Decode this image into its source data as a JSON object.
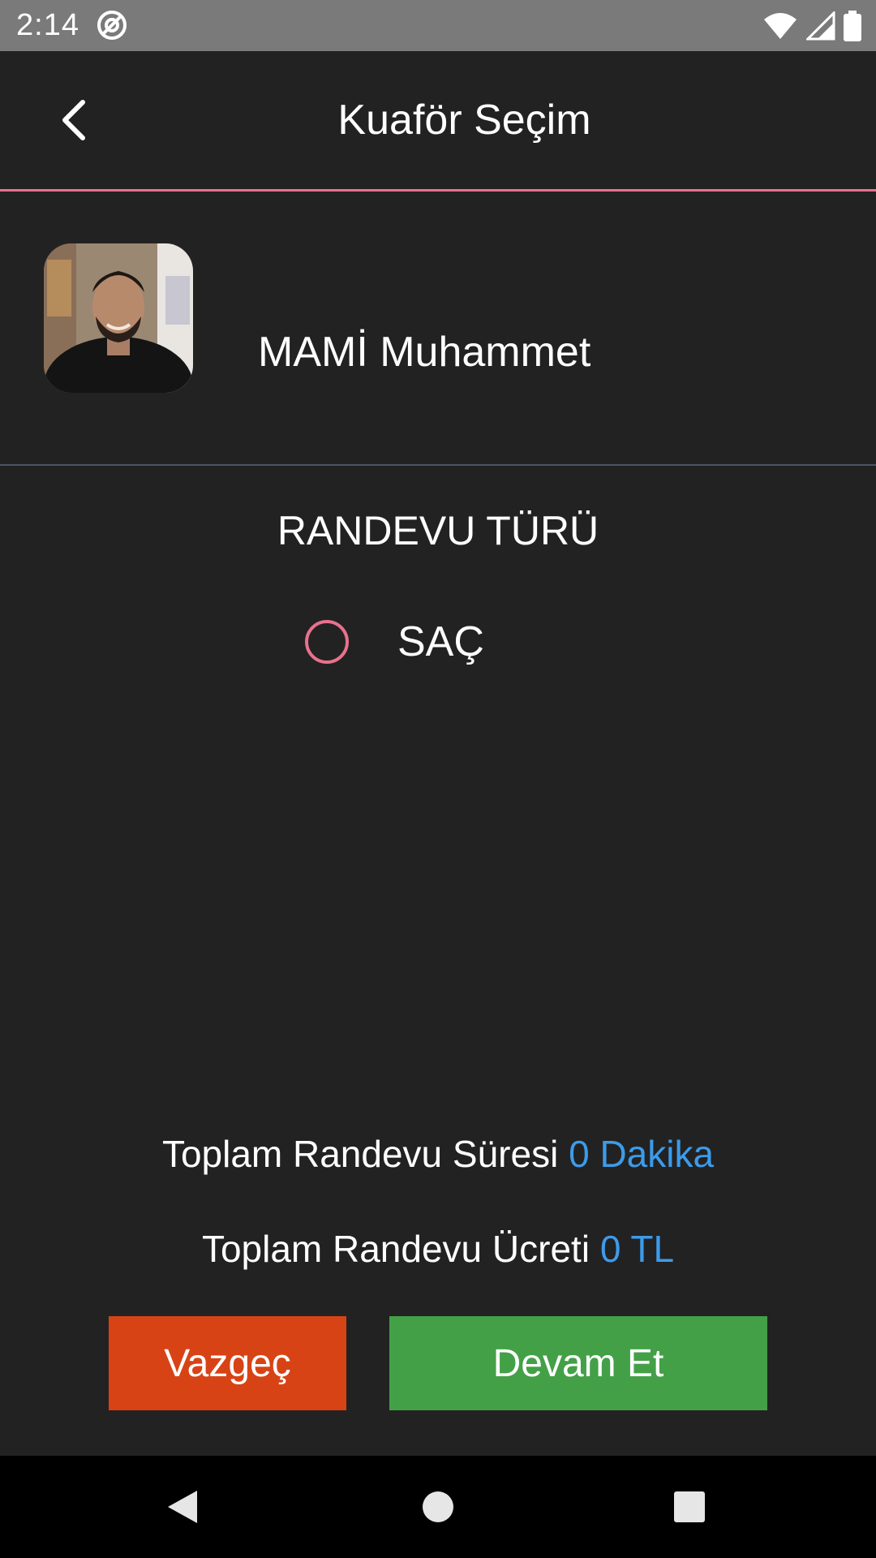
{
  "status_bar": {
    "time": "2:14"
  },
  "toolbar": {
    "title": "Kuaför Seçim",
    "back_icon": "chevron-left-icon"
  },
  "barber": {
    "name": "MAMİ Muhammet"
  },
  "appointment_type": {
    "title": "RANDEVU TÜRÜ",
    "options": [
      {
        "label": "SAÇ",
        "selected": false
      }
    ]
  },
  "totals": {
    "duration_label": "Toplam Randevu Süresi",
    "duration_value": "0 Dakika",
    "price_label": "Toplam Randevu Ücreti",
    "price_value": "0 TL"
  },
  "actions": {
    "cancel_label": "Vazgeç",
    "continue_label": "Devam Et"
  },
  "colors": {
    "background": "#222222",
    "accent_pink": "#e8718e",
    "accent_blue": "#3d9be9",
    "cancel_button": "#d84315",
    "continue_button": "#43a047"
  }
}
